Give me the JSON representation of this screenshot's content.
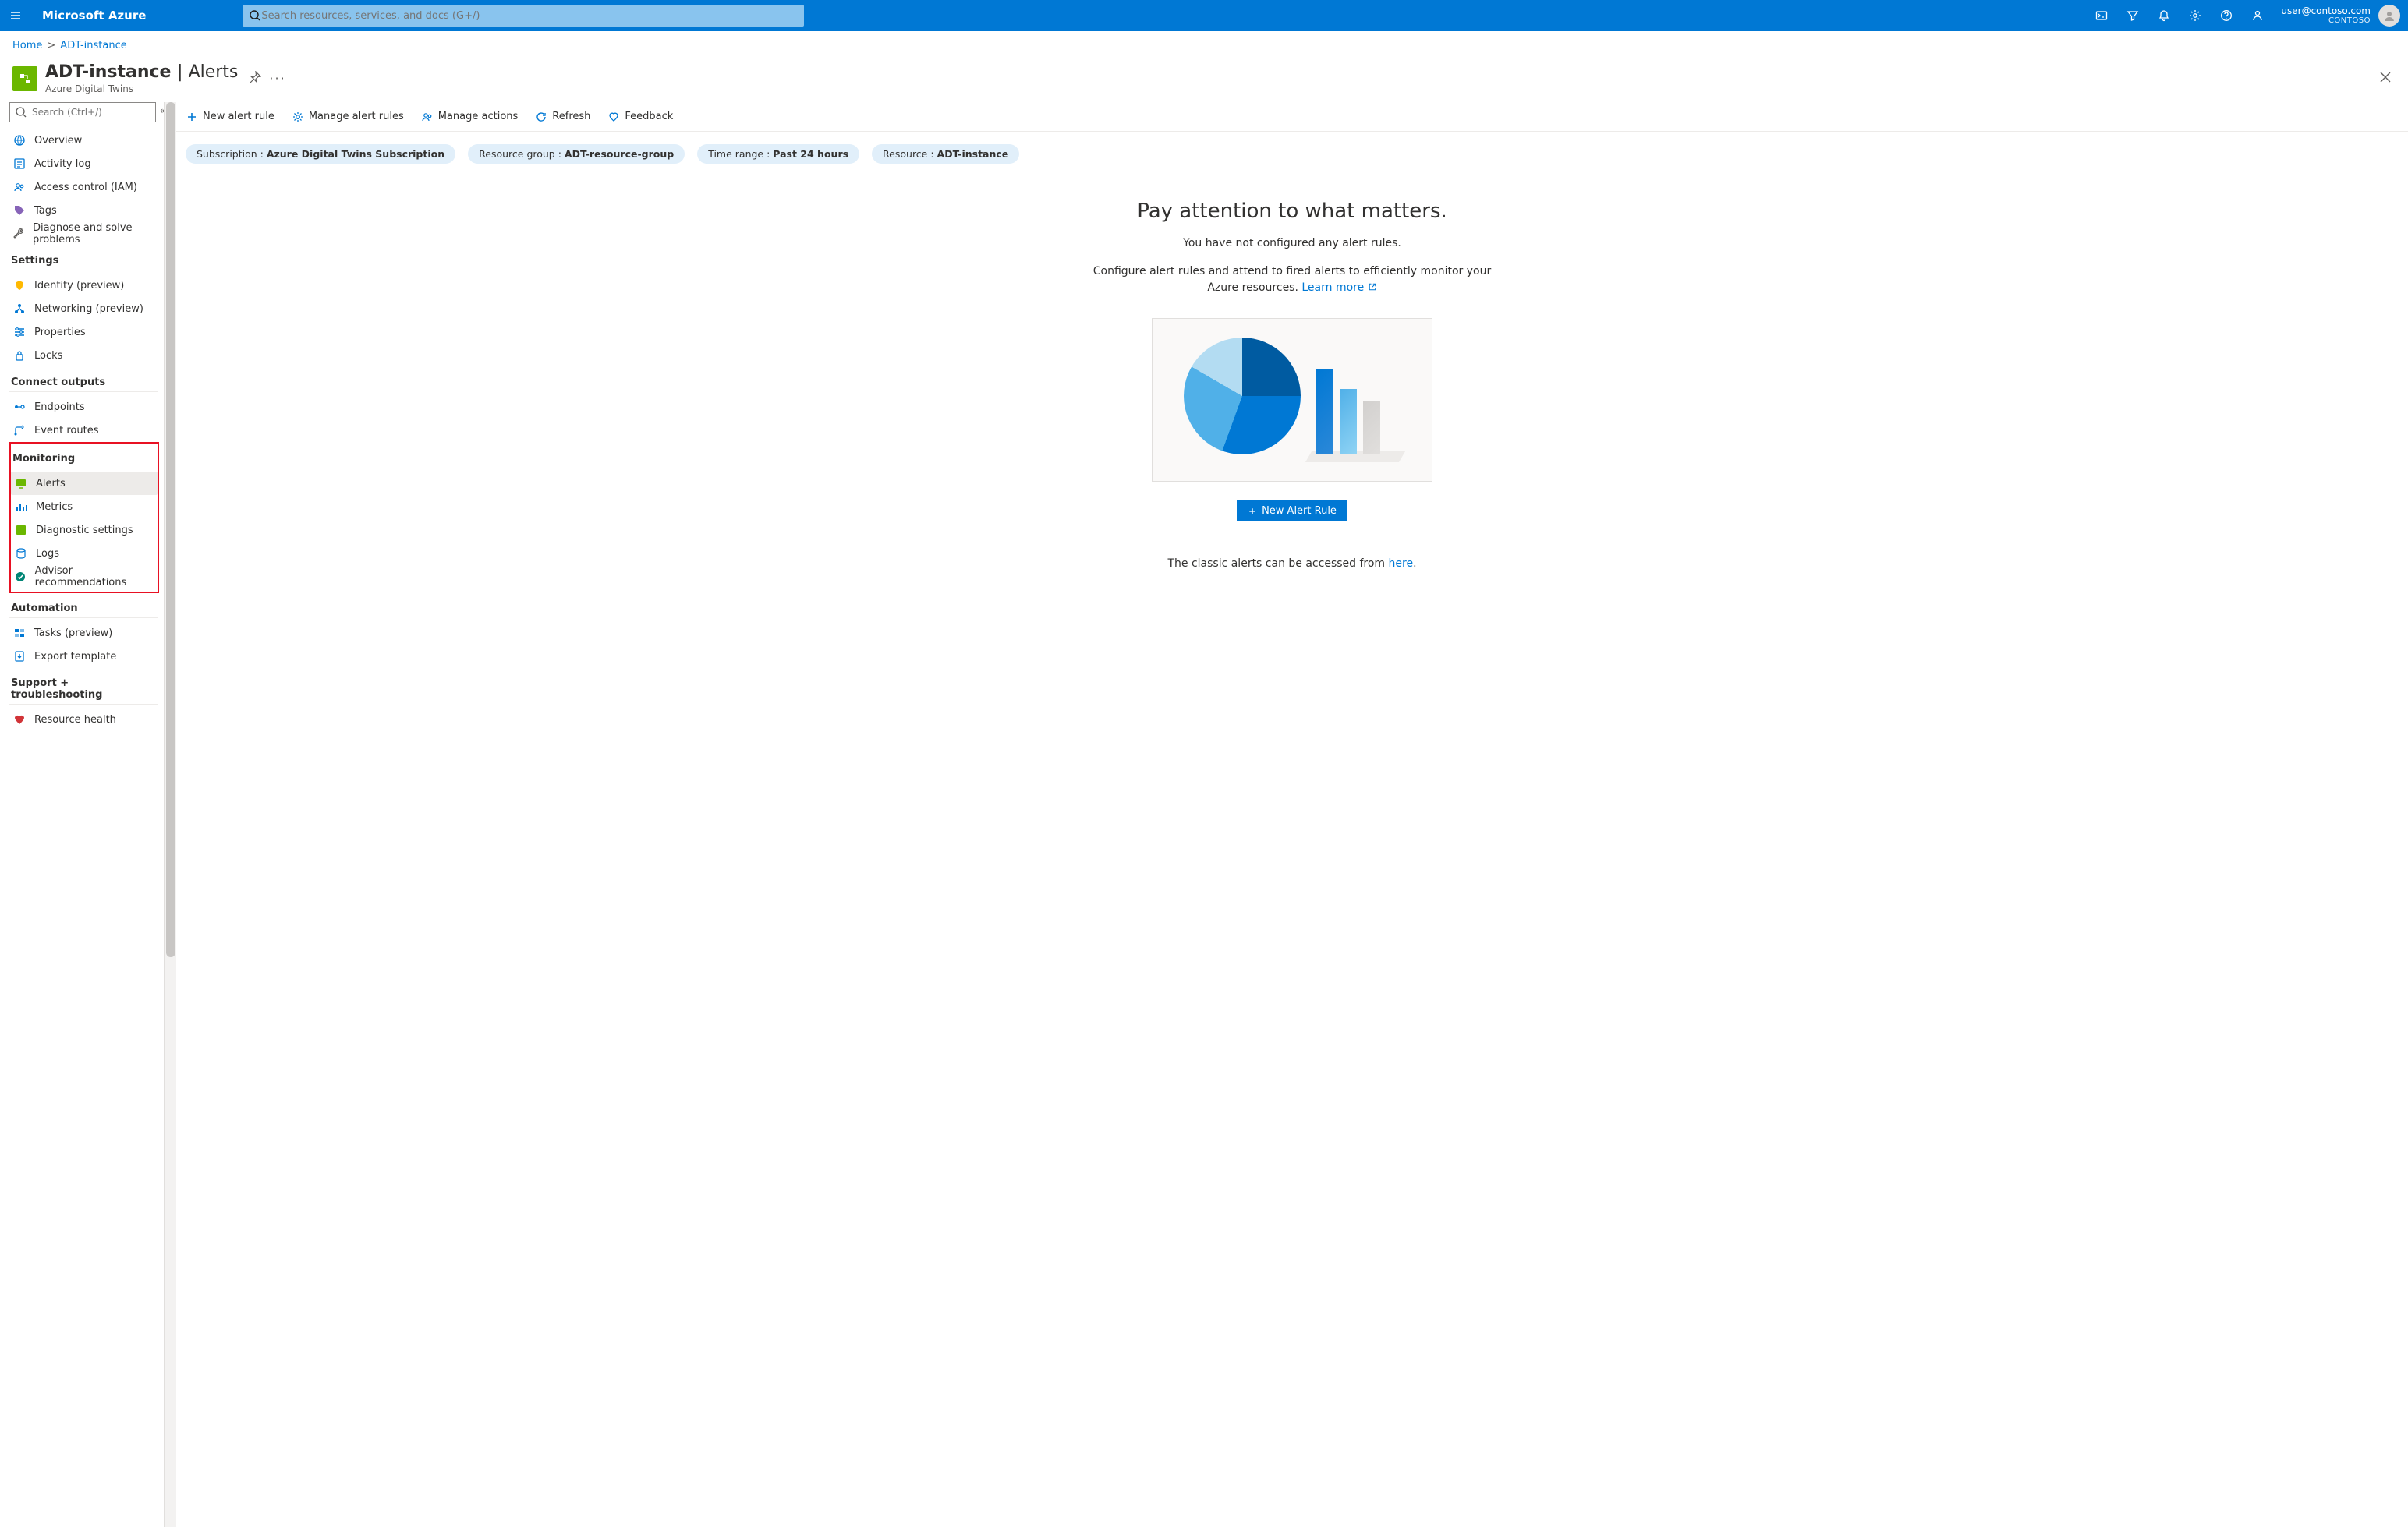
{
  "topbar": {
    "brand": "Microsoft Azure",
    "search_placeholder": "Search resources, services, and docs (G+/)",
    "user_email": "user@contoso.com",
    "org": "CONTOSO"
  },
  "breadcrumb": {
    "home": "Home",
    "current": "ADT-instance"
  },
  "page": {
    "title_main": "ADT-instance",
    "title_section": "Alerts",
    "subtitle": "Azure Digital Twins"
  },
  "leftSearch": {
    "placeholder": "Search (Ctrl+/)"
  },
  "sidebar": {
    "top": [
      {
        "label": "Overview"
      },
      {
        "label": "Activity log"
      },
      {
        "label": "Access control (IAM)"
      },
      {
        "label": "Tags"
      },
      {
        "label": "Diagnose and solve problems"
      }
    ],
    "settings_header": "Settings",
    "settings": [
      {
        "label": "Identity (preview)"
      },
      {
        "label": "Networking (preview)"
      },
      {
        "label": "Properties"
      },
      {
        "label": "Locks"
      }
    ],
    "connect_header": "Connect outputs",
    "connect": [
      {
        "label": "Endpoints"
      },
      {
        "label": "Event routes"
      }
    ],
    "monitoring_header": "Monitoring",
    "monitoring": [
      {
        "label": "Alerts"
      },
      {
        "label": "Metrics"
      },
      {
        "label": "Diagnostic settings"
      },
      {
        "label": "Logs"
      },
      {
        "label": "Advisor recommendations"
      }
    ],
    "automation_header": "Automation",
    "automation": [
      {
        "label": "Tasks (preview)"
      },
      {
        "label": "Export template"
      }
    ],
    "support_header": "Support + troubleshooting",
    "support": [
      {
        "label": "Resource health"
      }
    ]
  },
  "commands": {
    "new_alert_rule": "New alert rule",
    "manage_alert_rules": "Manage alert rules",
    "manage_actions": "Manage actions",
    "refresh": "Refresh",
    "feedback": "Feedback"
  },
  "pills": {
    "sub_label": "Subscription : ",
    "sub_value": "Azure Digital Twins Subscription",
    "rg_label": "Resource group : ",
    "rg_value": "ADT-resource-group",
    "tr_label": "Time range : ",
    "tr_value": "Past 24 hours",
    "res_label": "Resource : ",
    "res_value": "ADT-instance"
  },
  "hero": {
    "headline": "Pay attention to what matters.",
    "line1": "You have not configured any alert rules.",
    "line2a": "Configure alert rules and attend to fired alerts to efficiently monitor your",
    "line2b": "Azure resources. ",
    "learn_more": "Learn more",
    "cta": "New Alert Rule",
    "classic_pre": "The classic alerts can be accessed from ",
    "classic_link": "here",
    "classic_post": "."
  }
}
